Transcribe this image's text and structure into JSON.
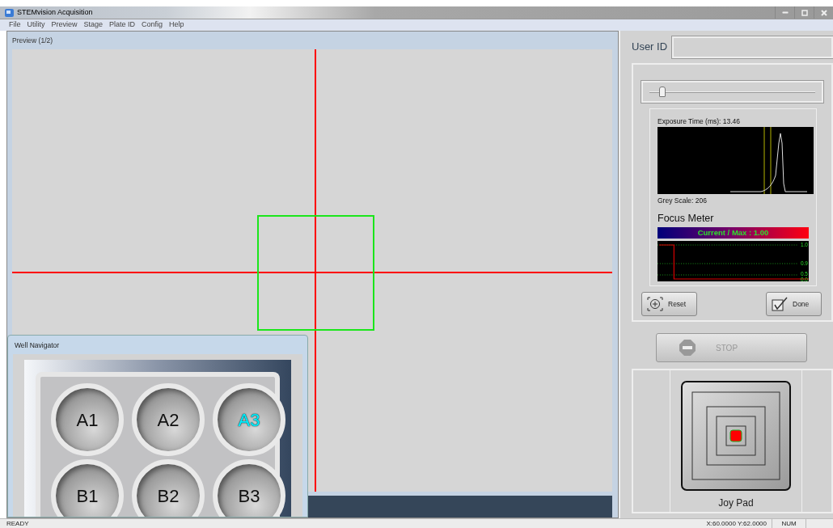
{
  "window": {
    "title": "STEMvision Acquisition"
  },
  "menu": [
    "File",
    "Utility",
    "Preview",
    "Stage",
    "Plate ID",
    "Config",
    "Help"
  ],
  "preview": {
    "title": "Preview (1/2)"
  },
  "well_navigator": {
    "title": "Well Navigator",
    "wells": [
      {
        "label": "A1",
        "selected": false
      },
      {
        "label": "A2",
        "selected": false
      },
      {
        "label": "A3",
        "selected": true
      },
      {
        "label": "B1",
        "selected": false
      },
      {
        "label": "B2",
        "selected": false
      },
      {
        "label": "B3",
        "selected": false
      }
    ]
  },
  "user_id": {
    "label": "User ID"
  },
  "exposure": {
    "level": 0.08,
    "exposure_text": "Exposure Time (ms):  13.46",
    "grey_scale": "Grey Scale: 206"
  },
  "focus_meter": {
    "title": "Focus Meter",
    "reading": "Current / Max : 1.00",
    "scale_labels": [
      "1.0",
      "0.9",
      "0.5",
      "0.0"
    ]
  },
  "buttons": {
    "reset": "Reset",
    "done": "Done",
    "stop": {
      "label": "STOP",
      "disabled": true
    }
  },
  "joy_pad": {
    "label": "Joy Pad"
  },
  "status_bar": {
    "state": "READY",
    "position": "X:60.0000  Y:62.0000",
    "num": "NUM"
  }
}
